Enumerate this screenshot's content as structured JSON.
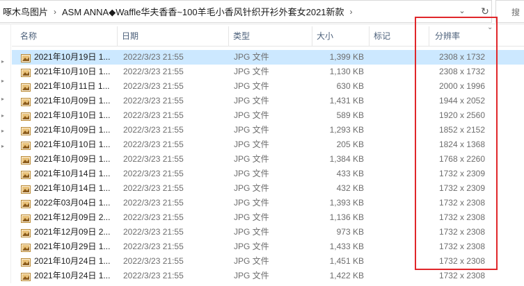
{
  "address": {
    "crumbs": [
      "啄木鸟图片",
      "ASM ANNA◆Waffle华夫香香~100羊毛小香风针织开衫外套女2021新款"
    ],
    "search_placeholder": "搜"
  },
  "columns": {
    "name": "名称",
    "date": "日期",
    "type": "类型",
    "size": "大小",
    "tags": "标记",
    "resolution": "分辨率"
  },
  "files": [
    {
      "name": "2021年10月19日 1...",
      "date": "2022/3/23 21:55",
      "type": "JPG 文件",
      "size": "1,399 KB",
      "resolution": "2308 x 1732"
    },
    {
      "name": "2021年10月10日 1...",
      "date": "2022/3/23 21:55",
      "type": "JPG 文件",
      "size": "1,130 KB",
      "resolution": "2308 x 1732"
    },
    {
      "name": "2021年10月11日 1...",
      "date": "2022/3/23 21:55",
      "type": "JPG 文件",
      "size": "630 KB",
      "resolution": "2000 x 1996"
    },
    {
      "name": "2021年10月09日 1...",
      "date": "2022/3/23 21:55",
      "type": "JPG 文件",
      "size": "1,431 KB",
      "resolution": "1944 x 2052"
    },
    {
      "name": "2021年10月10日 1...",
      "date": "2022/3/23 21:55",
      "type": "JPG 文件",
      "size": "589 KB",
      "resolution": "1920 x 2560"
    },
    {
      "name": "2021年10月09日 1...",
      "date": "2022/3/23 21:55",
      "type": "JPG 文件",
      "size": "1,293 KB",
      "resolution": "1852 x 2152"
    },
    {
      "name": "2021年10月10日 1...",
      "date": "2022/3/23 21:55",
      "type": "JPG 文件",
      "size": "205 KB",
      "resolution": "1824 x 1368"
    },
    {
      "name": "2021年10月09日 1...",
      "date": "2022/3/23 21:55",
      "type": "JPG 文件",
      "size": "1,384 KB",
      "resolution": "1768 x 2260"
    },
    {
      "name": "2021年10月14日 1...",
      "date": "2022/3/23 21:55",
      "type": "JPG 文件",
      "size": "433 KB",
      "resolution": "1732 x 2309"
    },
    {
      "name": "2021年10月14日 1...",
      "date": "2022/3/23 21:55",
      "type": "JPG 文件",
      "size": "432 KB",
      "resolution": "1732 x 2309"
    },
    {
      "name": "2022年03月04日 1...",
      "date": "2022/3/23 21:55",
      "type": "JPG 文件",
      "size": "1,393 KB",
      "resolution": "1732 x 2308"
    },
    {
      "name": "2021年12月09日 2...",
      "date": "2022/3/23 21:55",
      "type": "JPG 文件",
      "size": "1,136 KB",
      "resolution": "1732 x 2308"
    },
    {
      "name": "2021年12月09日 2...",
      "date": "2022/3/23 21:55",
      "type": "JPG 文件",
      "size": "973 KB",
      "resolution": "1732 x 2308"
    },
    {
      "name": "2021年10月29日 1...",
      "date": "2022/3/23 21:55",
      "type": "JPG 文件",
      "size": "1,433 KB",
      "resolution": "1732 x 2308"
    },
    {
      "name": "2021年10月24日 1...",
      "date": "2022/3/23 21:55",
      "type": "JPG 文件",
      "size": "1,451 KB",
      "resolution": "1732 x 2308"
    },
    {
      "name": "2021年10月24日 1...",
      "date": "2022/3/23 21:55",
      "type": "JPG 文件",
      "size": "1,422 KB",
      "resolution": "1732 x 2308"
    }
  ],
  "selected_row": 0,
  "colors": {
    "selection": "#cce8ff",
    "highlight_box": "#e0262a",
    "header_text": "#4c607a"
  },
  "icons": {
    "file": "jpg-image-icon",
    "refresh": "refresh-icon",
    "chevron": "chevron-down-icon"
  }
}
